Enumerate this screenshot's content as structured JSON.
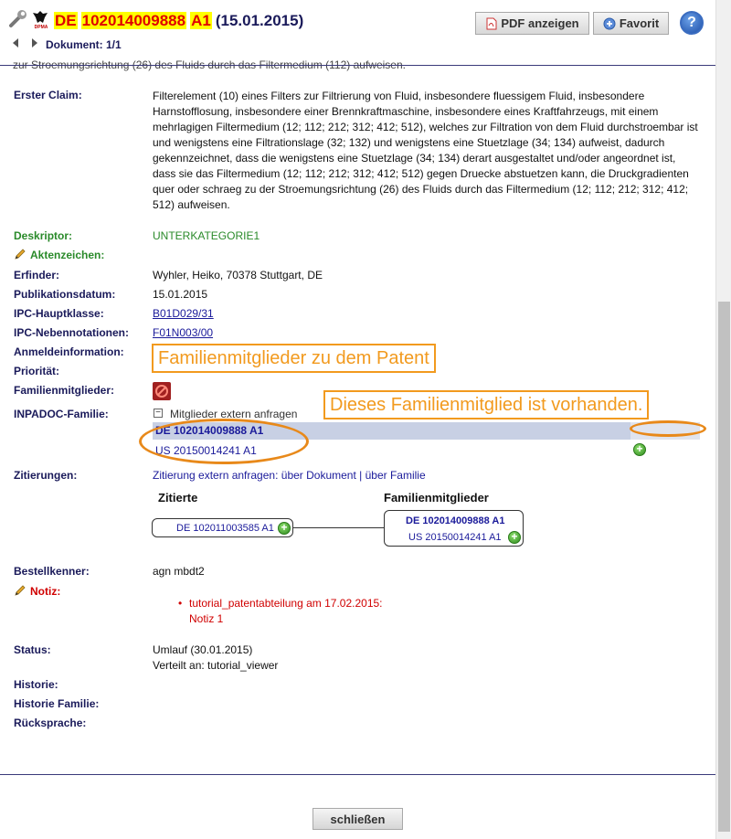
{
  "header": {
    "authority_caption": "DPMA",
    "doc_prefix": "DE",
    "doc_number": "102014009888",
    "doc_kind": "A1",
    "doc_date": "(15.01.2015)",
    "counter": "Dokument: 1/1",
    "pdf_button": "PDF anzeigen",
    "favorit_button": "Favorit",
    "help_label": "?",
    "cut_text": "zur Stroemungsrichtung (26) des Fluids durch das Filtermedium (112) aufweisen."
  },
  "fields": {
    "claim_label": "Erster Claim:",
    "claim_text": "Filterelement (10) eines Filters zur Filtrierung von Fluid, insbesondere fluessigem Fluid, insbesondere Harnstofflosung, insbesondere einer Brennkraftmaschine, insbesondere eines Kraftfahrzeugs, mit einem mehrlagigen Filtermedium (12; 112; 212; 312; 412; 512), welches zur Filtration von dem Fluid durchstroembar ist und wenigstens eine Filtrationslage (32; 132) und wenigstens eine Stuetzlage (34; 134) aufweist, dadurch gekennzeichnet, dass die wenigstens eine Stuetzlage (34; 134) derart ausgestaltet und/oder angeordnet ist, dass sie das Filtermedium (12; 112; 212; 312; 412; 512) gegen Druecke abstuetzen kann, die Druckgradienten quer oder schraeg zu der Stroemungsrichtung (26) des Fluids durch das Filtermedium (12; 112; 212; 312; 412; 512) aufweisen.",
    "deskriptor_label": "Deskriptor:",
    "deskriptor_value": "UNTERKATEGORIE1",
    "aktenzeichen_label": "Aktenzeichen:",
    "erfinder_label": "Erfinder:",
    "erfinder_value": "Wyhler, Heiko, 70378 Stuttgart, DE",
    "pubdate_label": "Publikationsdatum:",
    "pubdate_value": "15.01.2015",
    "ipc_main_label": "IPC-Hauptklasse:",
    "ipc_main_value": "B01D029/31",
    "ipc_side_label": "IPC-Nebennotationen:",
    "ipc_side_value": "F01N003/00",
    "anmelde_label": "Anmeldeinformation:",
    "prioritaet_label": "Priorität:",
    "familie_label": "Familienmitglieder:",
    "inpadoc_label": "INPADOC-Familie:",
    "extern_request": "Mitglieder extern anfragen",
    "family_member_1": "DE 102014009888 A1",
    "family_member_2": "US 20150014241 A1",
    "zitierungen_label": "Zitierungen:",
    "zitierung_prefix": "Zitierung extern anfragen:",
    "zitierung_doc": "über Dokument",
    "zitierung_sep": "|",
    "zitierung_family": "über Familie",
    "bestell_label": "Bestellkenner:",
    "bestell_value": "agn mbdt2",
    "notiz_label": "Notiz:",
    "notiz_line1": "tutorial_patentabteilung am 17.02.2015:",
    "notiz_line2": "Notiz 1",
    "status_label": "Status:",
    "status_line1": "Umlauf (30.01.2015)",
    "status_line2": "Verteilt an: tutorial_viewer",
    "historie_label": "Historie:",
    "historie_familie_label": "Historie Familie:",
    "ruecksprache_label": "Rücksprache:"
  },
  "citations": {
    "cited_heading": "Zitierte",
    "family_heading": "Familienmitglieder",
    "cited_doc": "DE 102011003585 A1",
    "family_doc_1": "DE 102014009888 A1",
    "family_doc_2": "US 20150014241 A1"
  },
  "annotations": {
    "family_members_note": "Familienmitglieder zu dem Patent",
    "exists_note": "Dieses Familienmitglied ist vorhanden."
  },
  "footer": {
    "close_button": "schließen"
  },
  "colors": {
    "highlight": "#ffff00",
    "annotation": "#f29a1e",
    "label_blue": "#1a1a5a",
    "link_blue": "#1a1a9a",
    "green": "#2a8a2a",
    "red": "#d00000"
  }
}
